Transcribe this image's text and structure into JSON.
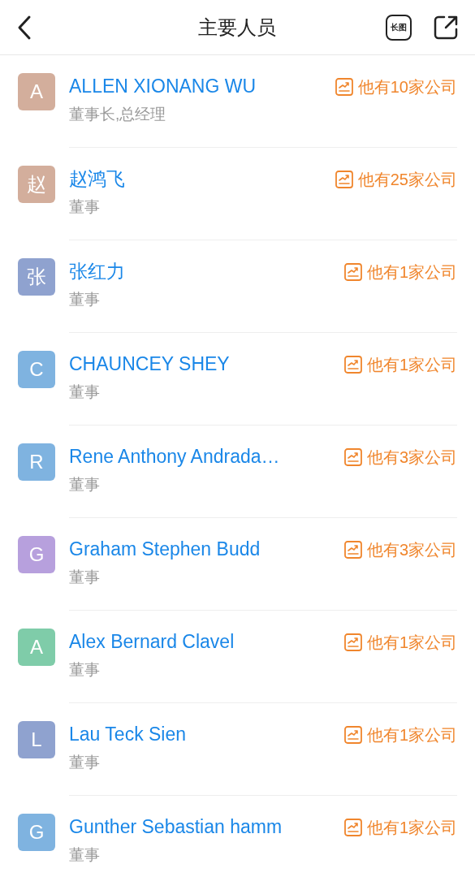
{
  "header": {
    "title": "主要人员",
    "long_image_label": "长图"
  },
  "people": [
    {
      "initial": "A",
      "color": "#d3ae9c",
      "name": "ALLEN XIONANG WU",
      "role": "董事长,总经理",
      "companies": "他有10家公司"
    },
    {
      "initial": "赵",
      "color": "#d3ae9c",
      "name": "赵鸿飞",
      "role": "董事",
      "companies": "他有25家公司"
    },
    {
      "initial": "张",
      "color": "#8fa2cf",
      "name": "张红力",
      "role": "董事",
      "companies": "他有1家公司"
    },
    {
      "initial": "C",
      "color": "#7fb3e0",
      "name": "CHAUNCEY SHEY",
      "role": "董事",
      "companies": "他有1家公司"
    },
    {
      "initial": "R",
      "color": "#7fb3e0",
      "name": "Rene Anthony Andrada…",
      "role": "董事",
      "companies": "他有3家公司"
    },
    {
      "initial": "G",
      "color": "#b7a0dd",
      "name": "Graham Stephen Budd",
      "role": "董事",
      "companies": "他有3家公司"
    },
    {
      "initial": "A",
      "color": "#7fcca9",
      "name": "Alex Bernard Clavel",
      "role": "董事",
      "companies": "他有1家公司"
    },
    {
      "initial": "L",
      "color": "#8fa2cf",
      "name": "Lau Teck Sien",
      "role": "董事",
      "companies": "他有1家公司"
    },
    {
      "initial": "G",
      "color": "#7fb3e0",
      "name": "Gunther Sebastian hamm",
      "role": "董事",
      "companies": "他有1家公司"
    }
  ]
}
